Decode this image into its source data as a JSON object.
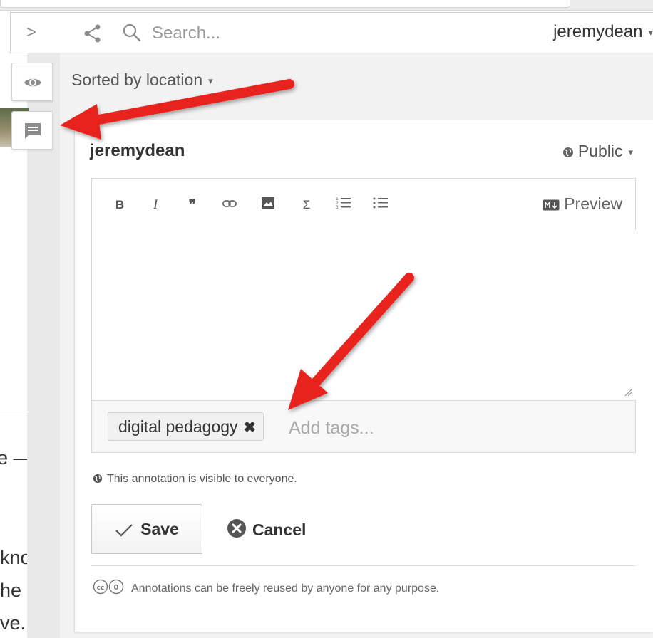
{
  "page": {
    "text_lines": [
      "e — to",
      "know",
      "he or",
      "ve."
    ]
  },
  "topbar": {
    "toggle_label": ">",
    "search_placeholder": "Search...",
    "user_name": "jeremydean"
  },
  "sort": {
    "label": "Sorted by location"
  },
  "annotation": {
    "author": "jeremydean",
    "privacy": "Public",
    "toolbar": {
      "bold": "B",
      "italic": "I",
      "quote": "❞",
      "sum": "Σ",
      "preview_label": "Preview"
    },
    "tags": [
      {
        "label": "digital pedagogy"
      }
    ],
    "tag_placeholder": "Add tags...",
    "visibility_note": "This annotation is visible to everyone.",
    "save_label": "Save",
    "cancel_label": "Cancel",
    "license_text": "Annotations can be freely reused by anyone for any purpose."
  },
  "colors": {
    "arrow": "#e8231c",
    "panel_bg": "#f2f2f2",
    "text": "#333333"
  }
}
